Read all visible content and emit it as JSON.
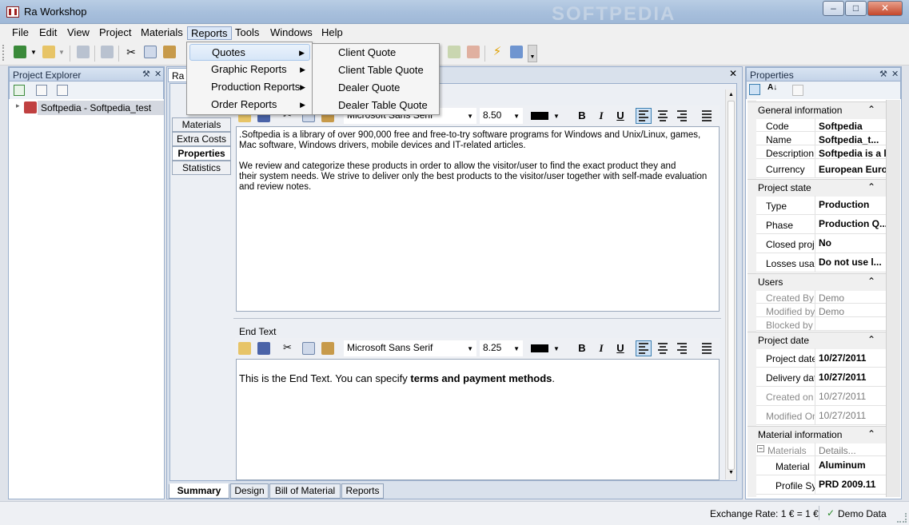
{
  "window": {
    "title": "Ra Workshop",
    "watermark": "SOFTPEDIA"
  },
  "menu": [
    "File",
    "Edit",
    "View",
    "Project",
    "Materials",
    "Reports",
    "Tools",
    "Windows",
    "Help"
  ],
  "reports_menu": {
    "items": [
      "Quotes",
      "Graphic Reports",
      "Production Reports",
      "Order Reports"
    ],
    "quotes_submenu": [
      "Client Quote",
      "Client Table Quote",
      "Dealer Quote",
      "Dealer Table Quote"
    ]
  },
  "explorer": {
    "title": "Project Explorer",
    "items": [
      "Softpedia - Softpedia_test"
    ]
  },
  "document": {
    "tab": "Ra",
    "side_tabs": [
      "Materials",
      "Extra Costs",
      "Properties",
      "Statistics"
    ],
    "start_editor": {
      "font": "Microsoft Sans Serif",
      "size": "8.50",
      "text1": ".Softpedia is a library of over 900,000 free and free-to-try software programs for Windows and Unix/Linux, games,",
      "text2": "Mac software, Windows drivers, mobile devices and IT-related articles.",
      "text3": "We review and categorize these products in order to allow the visitor/user to find the exact product they and",
      "text4": "their system needs. We strive to deliver only the best products to the visitor/user together with self-made evaluation",
      "text5": "and review notes."
    },
    "end_editor": {
      "label": "End Text",
      "font": "Microsoft Sans Serif",
      "size": "8.25",
      "text_plain": "This is the End Text. You can specify ",
      "text_bold": "terms and payment methods",
      "text_end": "."
    },
    "format_buttons": {
      "bold": "B",
      "italic": "I",
      "underline": "U"
    },
    "bottom_tabs": [
      "Summary",
      "Design",
      "Bill of Material",
      "Reports"
    ]
  },
  "properties": {
    "title": "Properties",
    "categories": {
      "general": "General information",
      "state": "Project state",
      "users": "Users",
      "date": "Project date",
      "material": "Material information"
    },
    "general": [
      {
        "name": "Code",
        "value": "Softpedia"
      },
      {
        "name": "Name",
        "value": "Softpedia_t..."
      },
      {
        "name": "Description",
        "value": "Softpedia is a l"
      },
      {
        "name": "Currency",
        "value": "European Euro"
      }
    ],
    "state": [
      {
        "name": "Type",
        "value": "Production"
      },
      {
        "name": "Phase",
        "value": "Production Q..."
      },
      {
        "name": "Closed proje",
        "value": "No"
      },
      {
        "name": "Losses usag",
        "value": "Do not use l..."
      }
    ],
    "users": [
      {
        "name": "Created By",
        "value": "Demo"
      },
      {
        "name": "Modified by",
        "value": "Demo"
      },
      {
        "name": "Blocked by",
        "value": ""
      }
    ],
    "date": [
      {
        "name": "Project date",
        "value": "10/27/2011"
      },
      {
        "name": "Delivery dat",
        "value": "10/27/2011"
      },
      {
        "name": "Created on",
        "value": "10/27/2011"
      },
      {
        "name": "Modified On",
        "value": "10/27/2011"
      }
    ],
    "material": [
      {
        "name": "Materials",
        "value": "Details..."
      },
      {
        "name": "Material",
        "value": "Aluminum"
      },
      {
        "name": "Profile Sy:",
        "value": "PRD 2009.11"
      }
    ]
  },
  "status": {
    "exchange_rate": "Exchange Rate: 1 € = 1 €",
    "demo": "Demo Data"
  },
  "colors": {
    "accent": "#3c7fb1",
    "titlebar": "#a7bfdc",
    "panel_header": "#c4d3e8"
  }
}
